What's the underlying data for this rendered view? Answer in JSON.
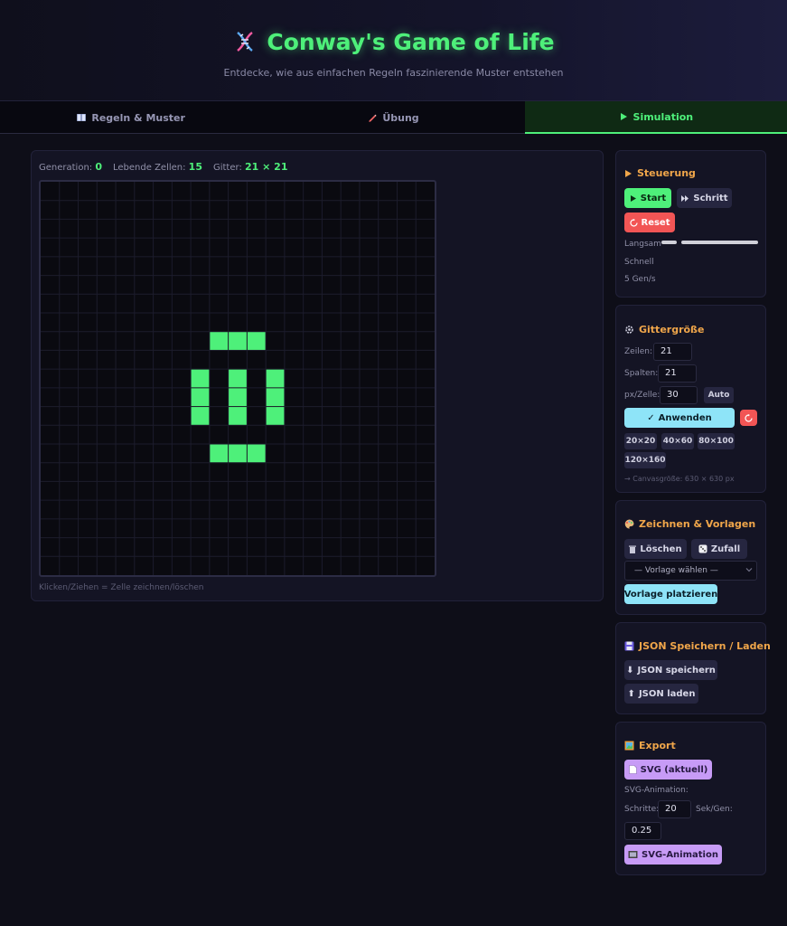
{
  "header": {
    "title": "Conway's Game of Life",
    "subtitle": "Entdecke, wie aus einfachen Regeln faszinierende Muster entstehen",
    "icon": "dna-icon"
  },
  "tabs": [
    {
      "label": "Regeln & Muster",
      "icon": "book-icon",
      "active": false
    },
    {
      "label": "Übung",
      "icon": "pencil-icon",
      "active": false
    },
    {
      "label": "Simulation",
      "icon": "play-icon",
      "active": true
    }
  ],
  "stats": {
    "generation_label": "Generation:",
    "generation_value": "0",
    "alive_label": "Lebende Zellen:",
    "alive_value": "15",
    "grid_label": "Gitter:",
    "grid_value": "21 × 21"
  },
  "grid": {
    "rows": 21,
    "cols": 21,
    "alive_cells": [
      [
        8,
        9
      ],
      [
        8,
        10
      ],
      [
        8,
        11
      ],
      [
        10,
        8
      ],
      [
        10,
        10
      ],
      [
        10,
        12
      ],
      [
        11,
        8
      ],
      [
        11,
        10
      ],
      [
        11,
        12
      ],
      [
        12,
        8
      ],
      [
        12,
        10
      ],
      [
        12,
        12
      ],
      [
        14,
        9
      ],
      [
        14,
        10
      ],
      [
        14,
        11
      ]
    ],
    "cell_color": "#4ef07a",
    "grid_line_color": "#1c1c2c"
  },
  "hint": "Klicken/Ziehen = Zelle zeichnen/löschen",
  "steuerung": {
    "title": "Steuerung",
    "start_label": "Start",
    "step_label": "Schritt",
    "reset_label": "Reset",
    "slow_label": "Langsam",
    "fast_label": "Schnell",
    "speed_text": "5 Gen/s"
  },
  "gitter": {
    "title": "Gittergröße",
    "rows_label": "Zeilen:",
    "rows_value": "21",
    "cols_label": "Spalten:",
    "cols_value": "21",
    "px_label": "px/Zelle:",
    "px_value": "30",
    "auto_label": "Auto",
    "apply_label": "Anwenden",
    "presets": [
      "20×20",
      "40×60",
      "80×100",
      "120×160"
    ],
    "canvas_info": "→ Canvasgröße: 630 × 630 px"
  },
  "zeichnen": {
    "title": "Zeichnen & Vorlagen",
    "clear_label": "Löschen",
    "random_label": "Zufall",
    "template_select": "— Vorlage wählen —",
    "place_label": "Vorlage platzieren"
  },
  "json": {
    "title": "JSON Speichern / Laden",
    "save_label": "JSON speichern",
    "load_label": "JSON laden"
  },
  "export": {
    "title": "Export",
    "svg_label": "SVG (aktuell)",
    "anim_heading": "SVG-Animation:",
    "steps_label": "Schritte:",
    "steps_value": "20",
    "sec_label": "Sek/Gen:",
    "sec_value": "0.25",
    "anim_label": "SVG-Animation"
  },
  "colors": {
    "accent_green": "#4ef07a",
    "panel_title": "#f0a64a",
    "reset_red": "#f25555",
    "apply_cyan": "#8ee4f8",
    "export_purple": "#c79bf6"
  }
}
